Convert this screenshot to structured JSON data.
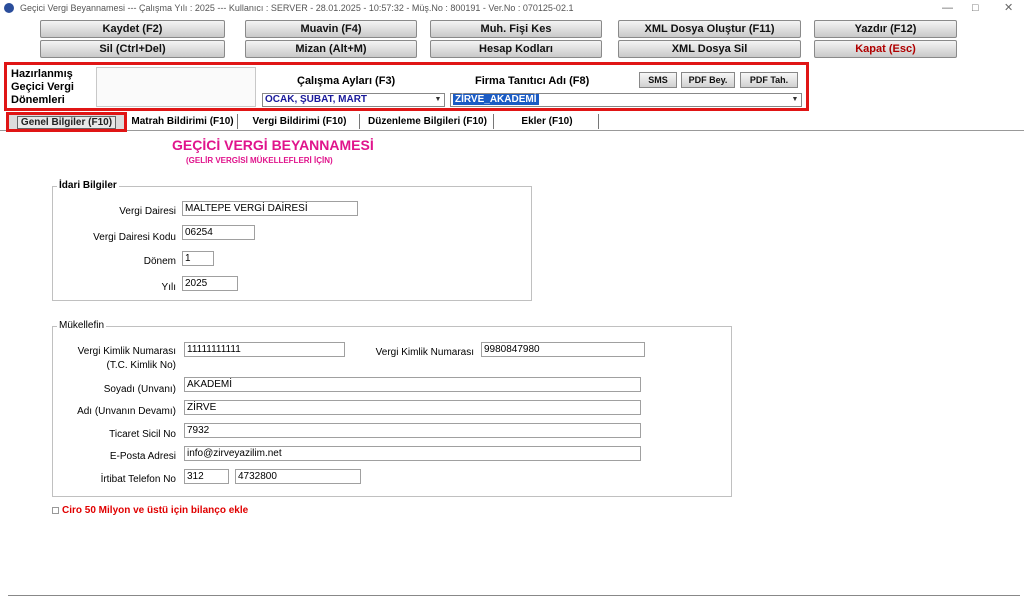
{
  "window": {
    "title": "Geçici Vergi Beyannamesi  ---  Çalışma Yılı : 2025  ---  Kullanıcı : SERVER - 28.01.2025 - 10:57:32  -  Müş.No : 800191  - Ver.No : 070125-02.1",
    "minimize": "—",
    "maximize": "□",
    "close": "✕"
  },
  "toolbar": {
    "row1": [
      "Kaydet (F2)",
      "Muavin (F4)",
      "Muh. Fişi Kes",
      "XML Dosya Oluştur (F11)",
      "Yazdır (F12)"
    ],
    "row2": [
      "Sil (Ctrl+Del)",
      "Mizan (Alt+M)",
      "Hesap Kodları",
      "XML Dosya Sil",
      "Kapat (Esc)"
    ]
  },
  "config": {
    "label": "Hazırlanmış Geçici Vergi Dönemleri",
    "months_label": "Çalışma Ayları (F3)",
    "months_value": "OCAK, ŞUBAT, MART",
    "firma_label": "Firma Tanıtıcı Adı (F8)",
    "firma_value": "ZİRVE_AKADEMİ",
    "sms": "SMS",
    "pdf_bey": "PDF Bey.",
    "pdf_tah": "PDF Tah."
  },
  "tabs": [
    "Genel Bilgiler (F10)",
    "Matrah Bildirimi (F10)",
    "Vergi Bildirimi (F10)",
    "Düzenleme Bilgileri (F10)",
    "Ekler (F10)"
  ],
  "header": {
    "title": "GEÇİCİ VERGİ BEYANNAMESİ",
    "subtitle": "(GELİR VERGİSİ MÜKELLEFLERİ İÇİN)"
  },
  "idari": {
    "legend": "İdari Bilgiler",
    "vergi_dairesi_label": "Vergi Dairesi",
    "vergi_dairesi": "MALTEPE VERGİ DAİRESİ",
    "vd_kodu_label": "Vergi Dairesi Kodu",
    "vd_kodu": "06254",
    "donem_label": "Dönem",
    "donem": "1",
    "yil_label": "Yılı",
    "yil": "2025"
  },
  "mukellef": {
    "legend": "Mükellefin",
    "vkn_tc_label": "Vergi Kimlik Numarası",
    "vkn_tc_sub": "(T.C. Kimlik No)",
    "vkn_tc": "11111111111",
    "vkn_label": "Vergi Kimlik Numarası",
    "vkn": "9980847980",
    "soyadi_label": "Soyadı (Unvanı)",
    "soyadi": "AKADEMİ",
    "adi_label": "Adı (Unvanın Devamı)",
    "adi": "ZİRVE",
    "ticaret_label": "Ticaret Sicil No",
    "ticaret": "7932",
    "eposta_label": "E-Posta Adresi",
    "eposta": "info@zirveyazilim.net",
    "telefon_label": "İrtibat Telefon No",
    "tel_kod": "312",
    "tel_no": "4732800"
  },
  "checkbox": {
    "label": "Ciro 50 Milyon ve üstü için bilanço ekle"
  }
}
